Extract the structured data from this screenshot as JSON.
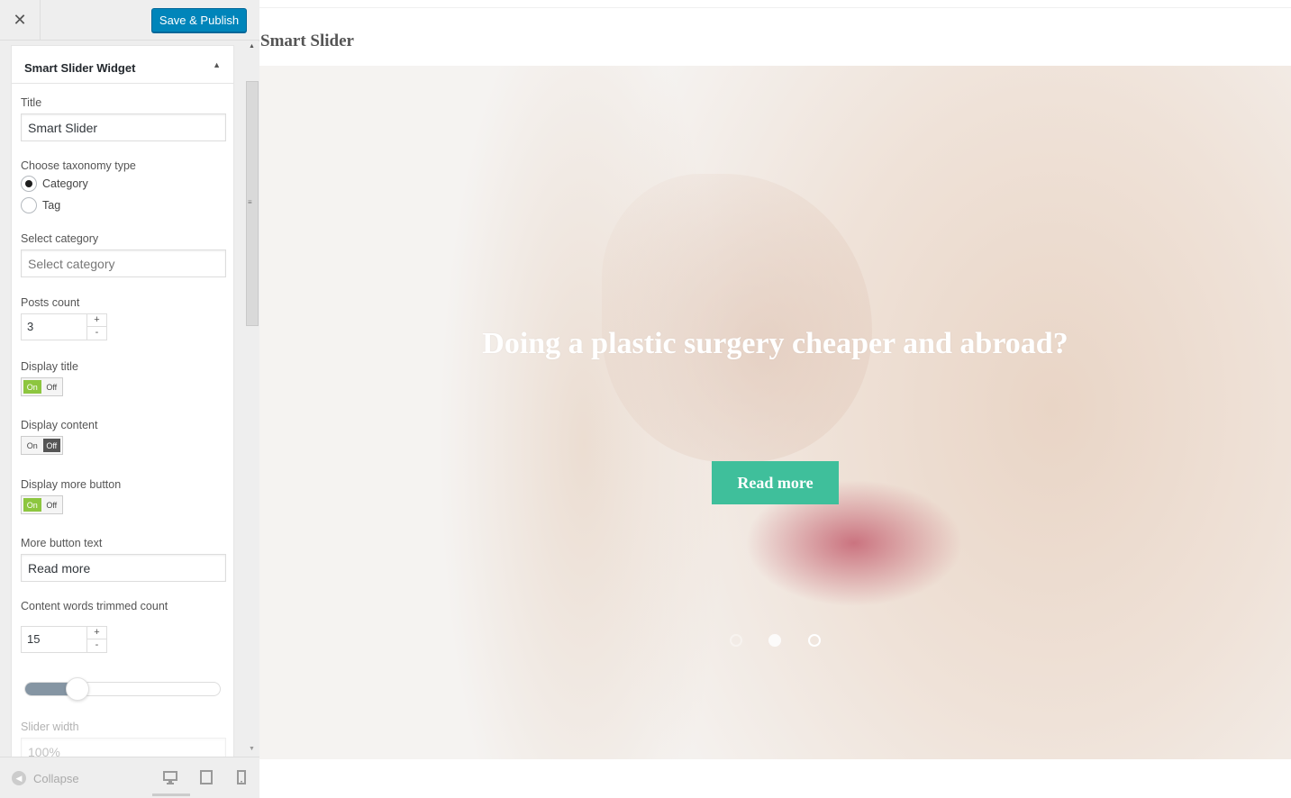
{
  "topbar": {
    "close_glyph": "✕",
    "save_label": "Save & Publish"
  },
  "widget": {
    "title": "Smart Slider Widget",
    "toggle_glyph": "▲",
    "title_label": "Title",
    "title_value": "Smart Slider",
    "taxonomy_label": "Choose taxonomy type",
    "taxonomy_options": [
      "Category",
      "Tag"
    ],
    "taxonomy_selected": "Category",
    "category_label": "Select category",
    "category_placeholder": "Select category",
    "posts_count_label": "Posts count",
    "posts_count_value": "3",
    "display_title_label": "Display title",
    "display_title_state": "On",
    "display_content_label": "Display content",
    "display_content_state": "Off",
    "display_more_label": "Display more button",
    "display_more_state": "On",
    "toggle_on": "On",
    "toggle_off": "Off",
    "stepper_plus": "+",
    "stepper_minus": "-",
    "more_text_label": "More button text",
    "more_text_value": "Read more",
    "trim_label": "Content words trimmed count",
    "trim_value": "15",
    "trim_slider_fraction": 0.27,
    "slider_width_label": "Slider width",
    "slider_width_placeholder": "100%"
  },
  "footer": {
    "collapse_label": "Collapse",
    "devices": [
      "desktop-icon",
      "tablet-icon",
      "mobile-icon"
    ]
  },
  "preview": {
    "site_title": "Smart Slider",
    "slide_heading": "Doing a plastic surgery cheaper and abroad?",
    "button_label": "Read more",
    "dots": 3,
    "active_dot": 2
  },
  "colors": {
    "publish": "#0085ba",
    "toggle_on": "#8dc63f",
    "read_more": "#3fbf9b"
  }
}
